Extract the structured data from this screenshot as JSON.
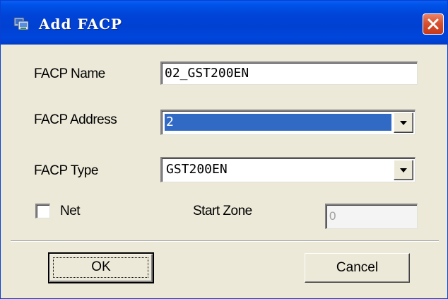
{
  "window": {
    "title": "Add FACP",
    "close_icon": "close-icon",
    "app_icon": "app-icon"
  },
  "form": {
    "facp_name": {
      "label": "FACP Name",
      "value": "02_GST200EN"
    },
    "facp_address": {
      "label": "FACP Address",
      "selected": "2"
    },
    "facp_type": {
      "label": "FACP Type",
      "selected": "GST200EN"
    },
    "net": {
      "label": "Net",
      "checked": false
    },
    "start_zone": {
      "label": "Start Zone",
      "value": "0",
      "disabled": true
    }
  },
  "buttons": {
    "ok_label": "OK",
    "cancel_label": "Cancel"
  },
  "colors": {
    "titlebar": "#0043d6",
    "close_button": "#d8512f",
    "dialog_background": "#ece9d8",
    "selection_highlight": "#316ac5"
  }
}
